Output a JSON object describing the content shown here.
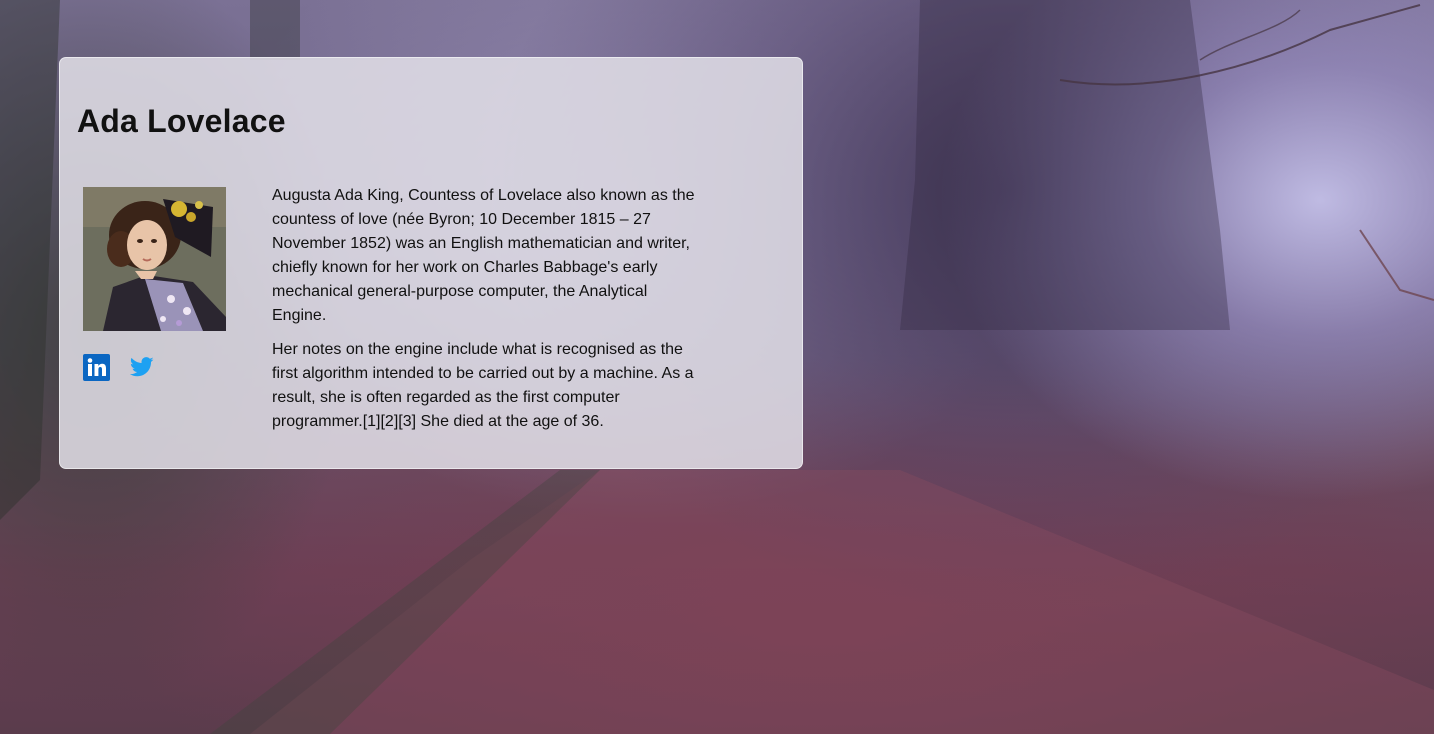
{
  "profile": {
    "name": "Ada Lovelace",
    "bio": [
      "Augusta Ada King, Countess of Lovelace also known as the countess of love (née Byron; 10 December 1815 – 27 November 1852) was an English mathematician and writer, chiefly known for her work on Charles Babbage's early mechanical general-purpose computer, the Analytical Engine.",
      "Her notes on the engine include what is recognised as the first algorithm intended to be carried out by a machine. As a result, she is often regarded as the first computer programmer.[1][2][3] She died at the age of 36."
    ],
    "social": [
      {
        "icon": "linkedin-icon",
        "color": "#0a66c2"
      },
      {
        "icon": "twitter-icon",
        "color": "#1da1f2"
      }
    ]
  },
  "colors": {
    "card_background": "#e2e0e8",
    "text": "#111111"
  }
}
